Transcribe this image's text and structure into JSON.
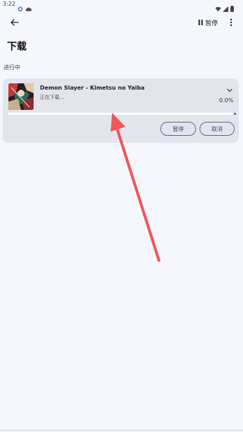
{
  "status_bar": {
    "time": "3:22"
  },
  "app_bar": {
    "pause_all_label": "暂停"
  },
  "page": {
    "title": "下载",
    "section": "进行中"
  },
  "download": {
    "title": "Demon Slayer - Kimetsu no Yaiba",
    "status": "正在下载...",
    "percent": "0.0%",
    "progress": 0.0,
    "pause_label": "暂停",
    "cancel_label": "取消"
  },
  "colors": {
    "background": "#f5f7fd",
    "card": "#e3e5ed",
    "accent": "#3a5ca8",
    "annotation_arrow": "#f0555a"
  }
}
